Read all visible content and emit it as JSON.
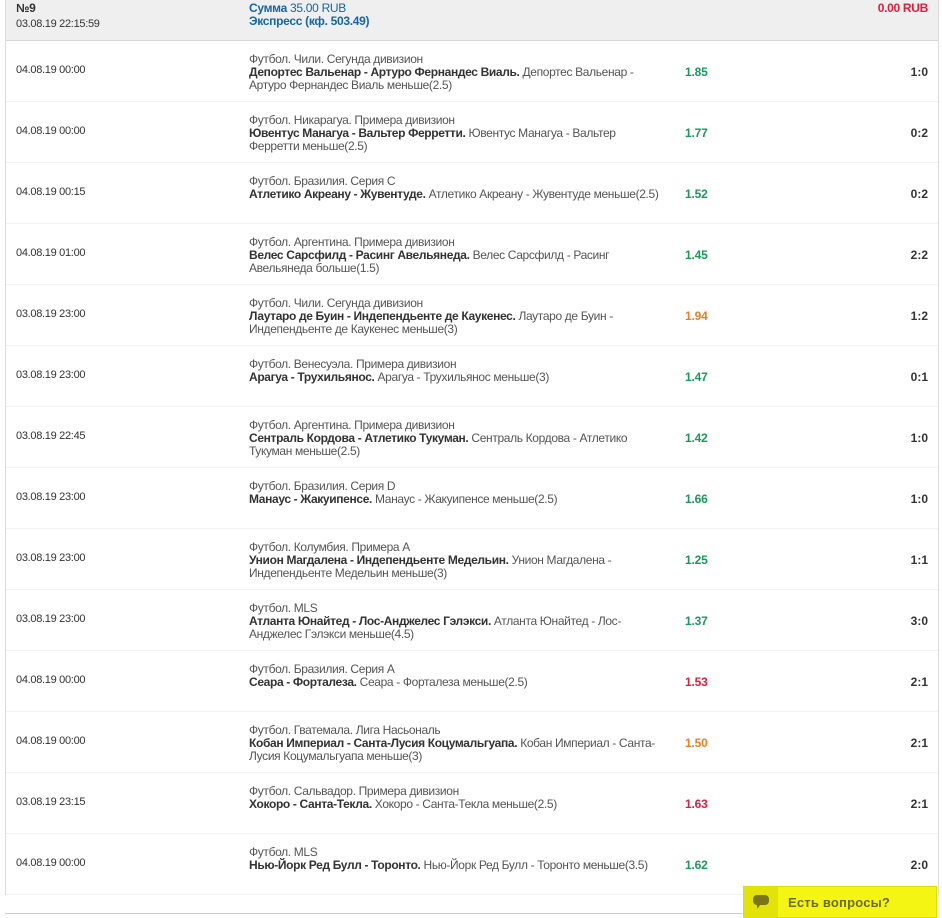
{
  "header": {
    "number": "№9",
    "datetime": "03.08.19 22:15:59",
    "sum_label": "Сумма",
    "sum_value": "35.00 RUB",
    "express": "Экспресс (кф. 503.49)",
    "payout": "0.00 RUB"
  },
  "colors": {
    "green": "#1a9a5a",
    "orange": "#ee7d22",
    "red": "#e21d3c"
  },
  "rows": [
    {
      "date": "04.08.19 00:00",
      "league": "Футбол. Чили. Сегунда дивизион",
      "match": "Депортес Вальенар - Артуро Фернандес Виаль.",
      "bet": "Депортес Вальенар - Артуро Фернандес Виаль меньше(2.5)",
      "odd": "1.85",
      "odd_color": "green",
      "score": "1:0"
    },
    {
      "date": "04.08.19 00:00",
      "league": "Футбол. Никарагуа. Примера дивизион",
      "match": "Ювентус Манагуа - Вальтер Ферретти.",
      "bet": "Ювентус Манагуа - Вальтер Ферретти меньше(2.5)",
      "odd": "1.77",
      "odd_color": "green",
      "score": "0:2"
    },
    {
      "date": "04.08.19 00:15",
      "league": "Футбол. Бразилия. Серия С",
      "match": "Атлетико Акреану - Жувентуде.",
      "bet": "Атлетико Акреану - Жувентуде меньше(2.5)",
      "odd": "1.52",
      "odd_color": "green",
      "score": "0:2"
    },
    {
      "date": "04.08.19 01:00",
      "league": "Футбол. Аргентина. Примера дивизион",
      "match": "Велес Сарсфилд - Расинг Авельянеда.",
      "bet": "Велес Сарсфилд - Расинг Авельянеда больше(1.5)",
      "odd": "1.45",
      "odd_color": "green",
      "score": "2:2"
    },
    {
      "date": "03.08.19 23:00",
      "league": "Футбол. Чили. Сегунда дивизион",
      "match": "Лаутаро де Буин - Индепендьенте де Каукенес.",
      "bet": "Лаутаро де Буин - Индепендьенте де Каукенес меньше(3)",
      "odd": "1.94",
      "odd_color": "orange",
      "score": "1:2"
    },
    {
      "date": "03.08.19 23:00",
      "league": "Футбол. Венесуэла. Примера дивизион",
      "match": "Арагуа - Трухильянос.",
      "bet": "Арагуа - Трухильянос меньше(3)",
      "odd": "1.47",
      "odd_color": "green",
      "score": "0:1"
    },
    {
      "date": "03.08.19 22:45",
      "league": "Футбол. Аргентина. Примера дивизион",
      "match": "Сентраль Кордова - Атлетико Тукуман.",
      "bet": "Сентраль Кордова - Атлетико Тукуман меньше(2.5)",
      "odd": "1.42",
      "odd_color": "green",
      "score": "1:0"
    },
    {
      "date": "03.08.19 23:00",
      "league": "Футбол. Бразилия. Серия D",
      "match": "Манаус - Жакуипенсе.",
      "bet": "Манаус - Жакуипенсе меньше(2.5)",
      "odd": "1.66",
      "odd_color": "green",
      "score": "1:0"
    },
    {
      "date": "03.08.19 23:00",
      "league": "Футбол. Колумбия. Примера А",
      "match": "Унион Магдалена - Индепендьенте Медельин.",
      "bet": "Унион Магдалена - Индепендьенте Медельин меньше(3)",
      "odd": "1.25",
      "odd_color": "green",
      "score": "1:1"
    },
    {
      "date": "03.08.19 23:00",
      "league": "Футбол. MLS",
      "match": "Атланта Юнайтед - Лос-Анджелес Гэлэкси.",
      "bet": "Атланта Юнайтед - Лос-Анджелес Гэлэкси меньше(4.5)",
      "odd": "1.37",
      "odd_color": "green",
      "score": "3:0"
    },
    {
      "date": "04.08.19 00:00",
      "league": "Футбол. Бразилия. Серия А",
      "match": "Сеара - Форталеза.",
      "bet": "Сеара - Форталеза меньше(2.5)",
      "odd": "1.53",
      "odd_color": "red",
      "score": "2:1"
    },
    {
      "date": "04.08.19 00:00",
      "league": "Футбол. Гватемала. Лига Насьональ",
      "match": "Кобан Империал - Санта-Лусия Коцумальгуапа.",
      "bet": "Кобан Империал - Санта-Лусия Коцумальгуапа меньше(3)",
      "odd": "1.50",
      "odd_color": "orange",
      "score": "2:1"
    },
    {
      "date": "03.08.19 23:15",
      "league": "Футбол. Сальвадор. Примера дивизион",
      "match": "Хокоро - Санта-Текла.",
      "bet": "Хокоро - Санта-Текла меньше(2.5)",
      "odd": "1.63",
      "odd_color": "red",
      "score": "2:1"
    },
    {
      "date": "04.08.19 00:00",
      "league": "Футбол. MLS",
      "match": "Нью-Йорк Ред Булл - Торонто.",
      "bet": "Нью-Йорк Ред Булл - Торонто меньше(3.5)",
      "odd": "1.62",
      "odd_color": "green",
      "score": "2:0"
    }
  ],
  "chat": {
    "label": "Есть вопросы?",
    "icon": "speech-bubble-icon"
  }
}
